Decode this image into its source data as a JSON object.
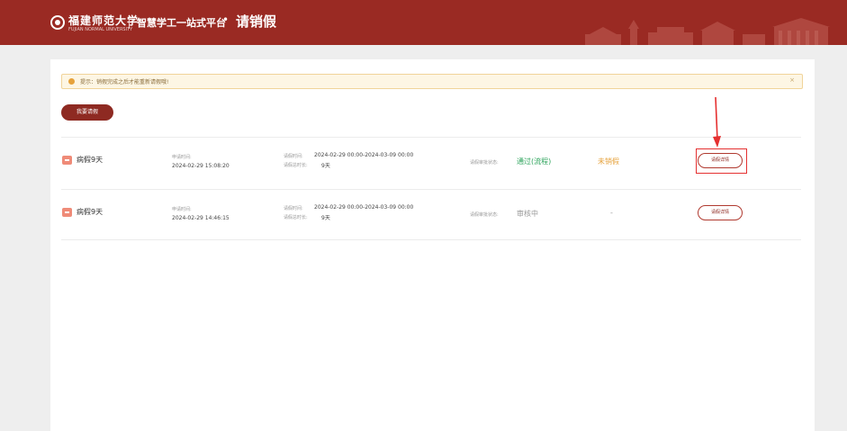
{
  "header": {
    "university_name": "福建师范大学",
    "university_subtitle": "FUJIAN NORMAL UNIVERSITY",
    "platform_name": "智慧学工一站式平台",
    "separator": "•",
    "page_name": "请销假"
  },
  "notice": {
    "text": "提示：销假完成之后才能重新请假哦!",
    "close": "×"
  },
  "apply_button": "我要请假",
  "records": [
    {
      "type": "病假9天",
      "apply_time_label": "申请时间:",
      "apply_time": "2024-02-29 15:08:20",
      "leave_time_label": "请假时间:",
      "leave_time": "2024-02-29 00:00-2024-03-09 00:00",
      "duration_label": "请假总时长:",
      "duration": "9天",
      "status_label": "请假审批状态:",
      "status": "通过(流程)",
      "cancel_status": "未销假",
      "detail_button": "请假详情"
    },
    {
      "type": "病假9天",
      "apply_time_label": "申请时间:",
      "apply_time": "2024-02-29 14:46:15",
      "leave_time_label": "请假时间:",
      "leave_time": "2024-02-29 00:00-2024-03-09 00:00",
      "duration_label": "请假总时长:",
      "duration": "9天",
      "status_label": "请假审批状态:",
      "status": "审核中",
      "cancel_status": "-",
      "detail_button": "请假详情"
    }
  ],
  "colors": {
    "brand": "#9a2a23",
    "pass": "#2ca35b",
    "warning": "#e6a23c",
    "annotation": "#e53030"
  }
}
